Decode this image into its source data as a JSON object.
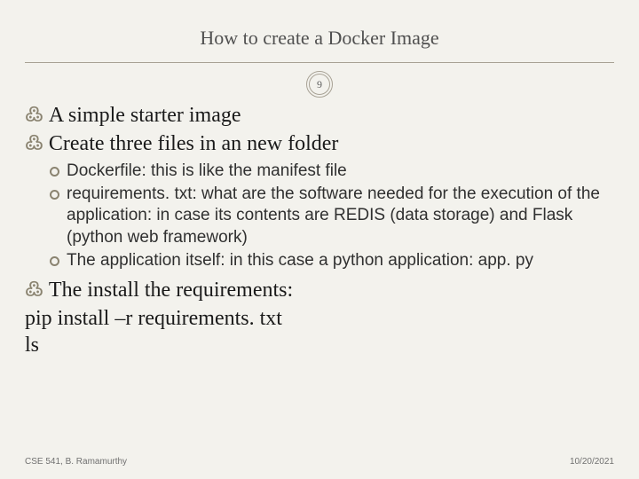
{
  "slide": {
    "title": "How to create a Docker Image",
    "page_number": "9",
    "bullets": [
      {
        "text": "A simple starter image"
      },
      {
        "text": "Create three files in an new folder"
      }
    ],
    "sub_bullets": [
      {
        "text": "Dockerfile: this is like the manifest file"
      },
      {
        "text": "requirements. txt: what are the software needed for the execution of the application: in case its contents are REDIS (data storage) and Flask (python web framework)"
      },
      {
        "text": "The application itself: in this case a python application: app. py"
      }
    ],
    "bullet_after": {
      "text": "The install the requirements:"
    },
    "plain_lines": [
      "pip install –r requirements. txt",
      "ls"
    ],
    "footer": {
      "left": "CSE 541, B. Ramamurthy",
      "right": "10/20/2021"
    }
  }
}
